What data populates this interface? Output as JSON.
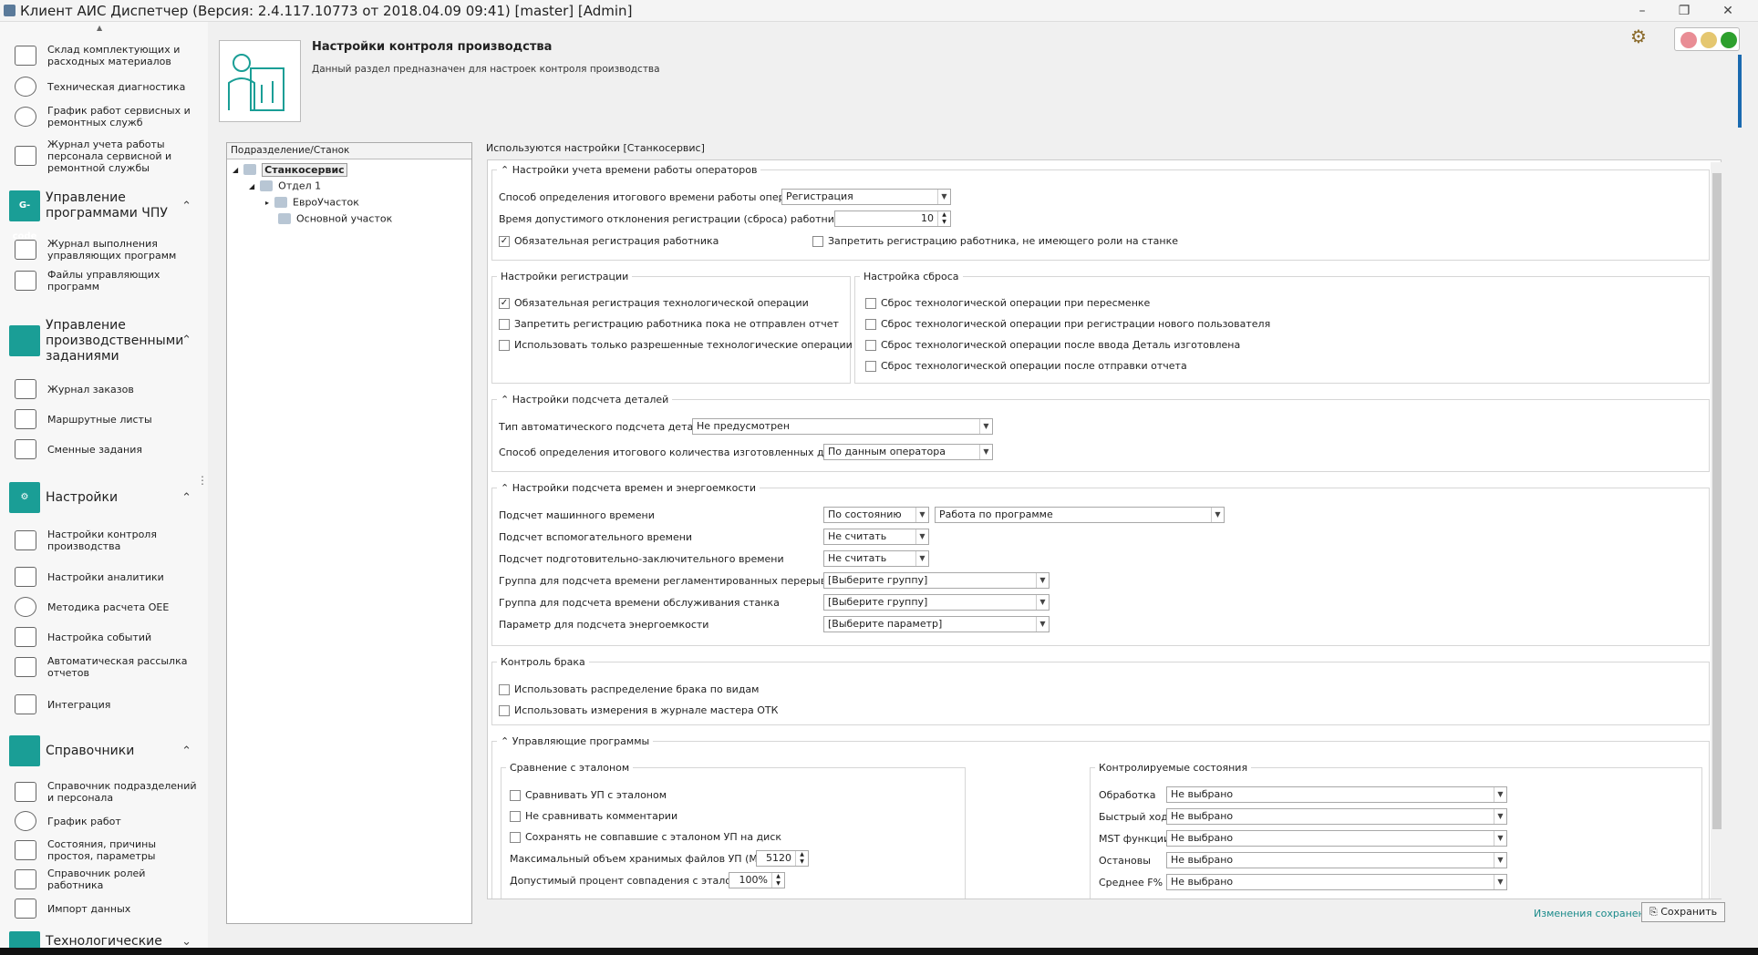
{
  "window": {
    "title": "Клиент АИС Диспетчер (Версия: 2.4.117.10773 от 2018.04.09 09:41) [master]  [Admin]"
  },
  "sidebar": {
    "items_top": [
      {
        "label": "Склад комплектующих и расходных материалов",
        "icon": "warehouse-icon"
      },
      {
        "label": "Техническая диагностика",
        "icon": "diagnostics-icon"
      },
      {
        "label": "График работ сервисных и ремонтных служб",
        "icon": "schedule-icon"
      },
      {
        "label": "Журнал учета работы персонала сервисной и ремонтной службы",
        "icon": "journal-icon"
      }
    ],
    "group_cnc": {
      "label": "Управление программами ЧПУ",
      "badge": "G-code"
    },
    "items_cnc": [
      {
        "label": "Журнал выполнения управляющих программ"
      },
      {
        "label": "Файлы управляющих программ"
      }
    ],
    "group_prod": {
      "label": "Управление производственными заданиями"
    },
    "items_prod": [
      {
        "label": "Журнал заказов"
      },
      {
        "label": "Маршрутные листы"
      },
      {
        "label": "Сменные задания"
      }
    ],
    "group_settings": {
      "label": "Настройки"
    },
    "items_settings": [
      {
        "label": "Настройки контроля производства"
      },
      {
        "label": "Настройки аналитики"
      },
      {
        "label": "Методика расчета OEE"
      },
      {
        "label": "Настройка событий"
      },
      {
        "label": "Автоматическая рассылка отчетов"
      },
      {
        "label": "Интеграция"
      }
    ],
    "group_ref": {
      "label": "Справочники"
    },
    "items_ref": [
      {
        "label": "Справочник подразделений и персонала"
      },
      {
        "label": "График работ"
      },
      {
        "label": "Состояния, причины простоя, параметры"
      },
      {
        "label": "Справочник ролей работника"
      },
      {
        "label": "Импорт данных"
      }
    ],
    "group_tech": {
      "label": "Технологические"
    }
  },
  "header": {
    "title": "Настройки контроля производства",
    "desc": "Данный раздел предназначен для настроек контроля производства"
  },
  "tree": {
    "header": "Подразделение/Станок",
    "nodes": [
      "Станкосервис",
      "Отдел 1",
      "ЕвроУчасток",
      "Основной участок"
    ]
  },
  "using": "Используются настройки [Станкосервис]",
  "g1": {
    "title": "Настройки учета времени работы операторов",
    "l1": "Способ определения итогового времени работы оператора",
    "v1": "Регистрация",
    "l2": "Время допустимого отклонения регистрации (сброса) работника (мин)",
    "v2": "10",
    "c1": "Обязательная регистрация работника",
    "c2": "Запретить регистрацию работника, не имеющего роли на станке"
  },
  "g2": {
    "title": "Настройки регистрации",
    "c1": "Обязательная регистрация технологической операции",
    "c2": "Запретить регистрацию работника пока не отправлен отчет",
    "c3": "Использовать только разрешенные технологические операции"
  },
  "g3": {
    "title": "Настройка сброса",
    "c1": "Сброс технологической операции при пересменке",
    "c2": "Сброс технологической операции при регистрации нового пользователя",
    "c3": "Сброс технологической операции после ввода Деталь изготовлена",
    "c4": "Сброс технологической операции после отправки отчета"
  },
  "g4": {
    "title": "Настройки подсчета деталей",
    "l1": "Тип автоматического подсчета деталей",
    "v1": "Не предусмотрен",
    "l2": "Способ определения итогового количества изготовленных деталей",
    "v2": "По данным оператора"
  },
  "g5": {
    "title": "Настройки подсчета времен и энергоемкости",
    "rows": [
      {
        "label": "Подсчет машинного времени",
        "v": "По состоянию",
        "v2": "Работа по программе"
      },
      {
        "label": "Подсчет вспомогательного времени",
        "v": "Не считать"
      },
      {
        "label": "Подсчет подготовительно-заключительного времени",
        "v": "Не считать"
      },
      {
        "label": "Группа для подсчета времени регламентированных перерывов",
        "v": "[Выберите группу]"
      },
      {
        "label": "Группа для подсчета времени обслуживания станка",
        "v": "[Выберите группу]"
      },
      {
        "label": "Параметр для подсчета энергоемкости",
        "v": "[Выберите параметр]"
      }
    ]
  },
  "g6": {
    "title": "Контроль брака",
    "c1": "Использовать распределение брака по видам",
    "c2": "Использовать измерения в журнале мастера ОТК"
  },
  "g7": {
    "title": "Управляющие программы",
    "sub1": {
      "title": "Сравнение с эталоном",
      "c1": "Сравнивать УП с эталоном",
      "c2": "Не сравнивать комментарии",
      "c3": "Сохранять не совпавшие с эталоном УП на диск",
      "l1": "Максимальный объем хранимых файлов УП (Мбайт)",
      "v1": "5120",
      "l2": "Допустимый процент совпадения с эталоном",
      "v2": "100%"
    },
    "sub2": {
      "title": "Контролируемые состояния",
      "rows": [
        {
          "label": "Обработка",
          "v": "Не выбрано"
        },
        {
          "label": "Быстрый ход",
          "v": "Не выбрано"
        },
        {
          "label": "MST функции",
          "v": "Не выбрано"
        },
        {
          "label": "Остановы",
          "v": "Не выбрано"
        },
        {
          "label": "Среднее F%",
          "v": "Не выбрано"
        }
      ]
    }
  },
  "footer": {
    "saved": "Изменения сохранены",
    "save": "Сохранить"
  }
}
